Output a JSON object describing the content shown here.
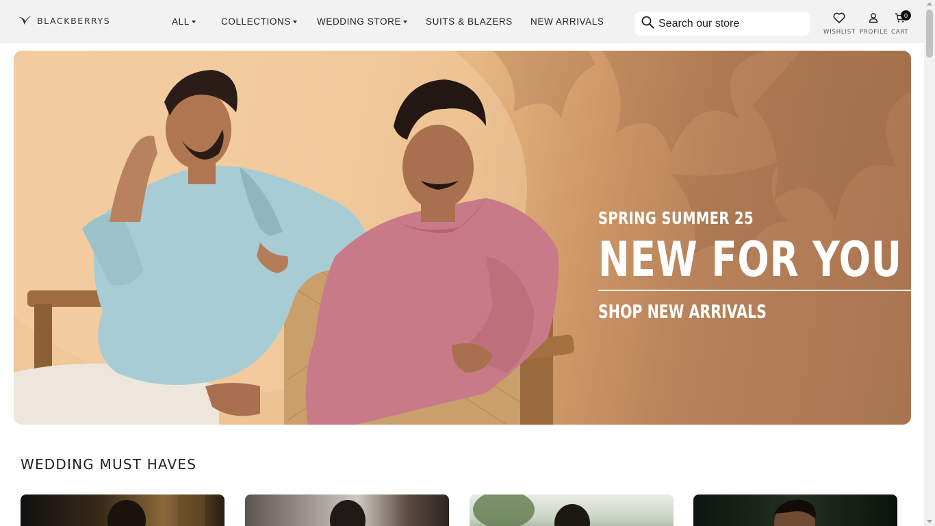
{
  "header": {
    "logo_text": "BLACKBERRYS",
    "nav": [
      {
        "label": "ALL",
        "has_dropdown": true
      },
      {
        "label": "COLLECTIONS",
        "has_dropdown": true
      },
      {
        "label": "WEDDING STORE",
        "has_dropdown": true
      },
      {
        "label": "SUITS & BLAZERS",
        "has_dropdown": false
      },
      {
        "label": "NEW ARRIVALS",
        "has_dropdown": false
      }
    ],
    "search": {
      "placeholder": "Search our store",
      "icon": "search-icon"
    },
    "wishlist_label": "WISHLIST",
    "profile_label": "PROFILE",
    "cart_label": "CART",
    "cart_count": "0"
  },
  "hero": {
    "eyebrow": "SPRING SUMMER 25",
    "title": "NEW FOR YOU",
    "cta": "SHOP NEW ARRIVALS"
  },
  "section": {
    "title": "WEDDING MUST HAVES"
  }
}
